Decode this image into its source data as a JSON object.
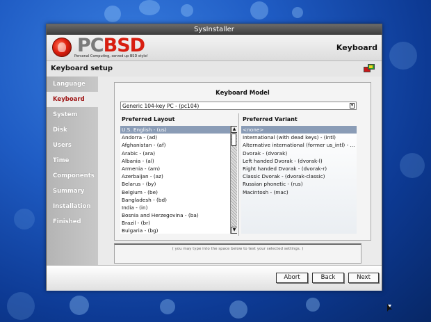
{
  "window": {
    "title": "SysInstaller"
  },
  "banner": {
    "logo_left": "PC",
    "logo_right": "BSD",
    "tagline": "Personal Computing, served up BSD style!",
    "page_title": "Keyboard"
  },
  "subheader": {
    "title": "Keyboard setup"
  },
  "sidebar": {
    "items": [
      {
        "label": "Language"
      },
      {
        "label": "Keyboard"
      },
      {
        "label": "System"
      },
      {
        "label": "Disk"
      },
      {
        "label": "Users"
      },
      {
        "label": "Time"
      },
      {
        "label": "Components"
      },
      {
        "label": "Summary"
      },
      {
        "label": "Installation"
      },
      {
        "label": "Finished"
      }
    ],
    "active_index": 1
  },
  "panel": {
    "title": "Keyboard Model",
    "model_value": "Generic 104-key PC - (pc104)",
    "layout_header": "Preferred Layout",
    "variant_header": "Preferred Variant",
    "layouts": [
      "U.S. English - (us)",
      "Andorra - (ad)",
      "Afghanistan - (af)",
      "Arabic - (ara)",
      "Albania - (al)",
      "Armenia - (am)",
      "Azerbaijan - (az)",
      "Belarus - (by)",
      "Belgium - (be)",
      "Bangladesh - (bd)",
      "India - (in)",
      "Bosnia and Herzegovina - (ba)",
      "Brazil - (br)",
      "Bulgaria - (bg)"
    ],
    "variants": [
      "<none>",
      "International (with dead keys) - (intl)",
      "Alternative international (former us_intl) - ...",
      "Dvorak - (dvorak)",
      "Left handed Dvorak - (dvorak-l)",
      "Right handed Dvorak - (dvorak-r)",
      "Classic Dvorak - (dvorak-classic)",
      "Russian phonetic - (rus)",
      "Macintosh - (mac)"
    ],
    "selected_layout_index": 0,
    "selected_variant_index": 0
  },
  "test_area": {
    "hint": "( you may type into the space below to test your selected settings. )"
  },
  "footer": {
    "abort_label": "Abort",
    "back_label": "Back",
    "next_label": "Next"
  }
}
